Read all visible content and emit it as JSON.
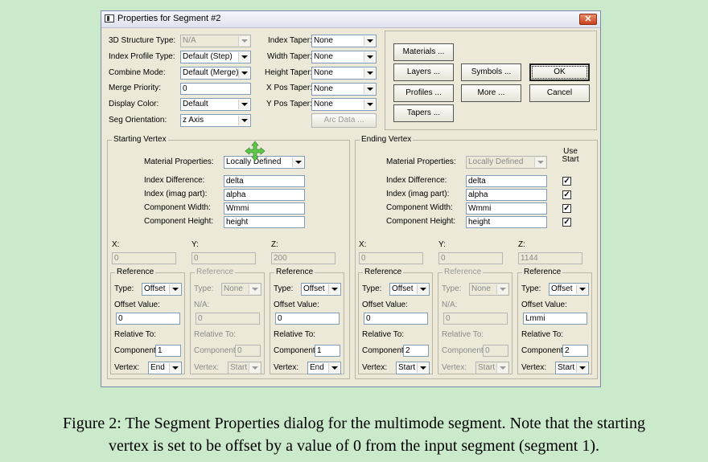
{
  "window": {
    "title": "Properties for Segment #2",
    "close": "✕"
  },
  "top_left": {
    "structure_type": {
      "label": "3D Structure Type:",
      "value": "N/A"
    },
    "index_profile": {
      "label": "Index Profile Type:",
      "value": "Default (Step)"
    },
    "combine_mode": {
      "label": "Combine Mode:",
      "value": "Default (Merge)"
    },
    "merge_priority": {
      "label": "Merge Priority:",
      "value": "0"
    },
    "display_color": {
      "label": "Display Color:",
      "value": "Default"
    },
    "seg_orientation": {
      "label": "Seg Orientation:",
      "value": "z Axis"
    }
  },
  "top_mid": {
    "index_taper": {
      "label": "Index Taper:",
      "value": "None"
    },
    "width_taper": {
      "label": "Width Taper:",
      "value": "None"
    },
    "height_taper": {
      "label": "Height Taper:",
      "value": "None"
    },
    "xpos_taper": {
      "label": "X Pos Taper:",
      "value": "None"
    },
    "ypos_taper": {
      "label": "Y Pos Taper:",
      "value": "None"
    },
    "arc_data": "Arc Data ..."
  },
  "buttons": {
    "materials": "Materials ...",
    "layers": "Layers ...",
    "profiles": "Profiles ...",
    "tapers": "Tapers ...",
    "symbols": "Symbols ...",
    "more": "More ...",
    "ok": "OK",
    "cancel": "Cancel"
  },
  "starting": {
    "title": "Starting Vertex",
    "mat_label": "Material Properties:",
    "mat_value": "Locally Defined",
    "idx_diff_label": "Index Difference:",
    "idx_diff": "delta",
    "idx_imag_label": "Index (imag part):",
    "idx_imag": "alpha",
    "width_label": "Component Width:",
    "width": "Wmmi",
    "height_label": "Component Height:",
    "height": "height",
    "x_label": "X:",
    "x": "0",
    "y_label": "Y:",
    "y": "0",
    "z_label": "Z:",
    "z": "200",
    "refs": [
      {
        "title": "Reference",
        "type_label": "Type:",
        "type": "Offset",
        "off_label": "Offset Value:",
        "off": "0",
        "rel_label": "Relative To:",
        "comp_label": "Component:",
        "comp": "1",
        "vert_label": "Vertex:",
        "vert": "End"
      },
      {
        "title": "Reference",
        "type_label": "Type:",
        "type": "None",
        "off_label": "N/A:",
        "off": "0",
        "rel_label": "Relative To:",
        "comp_label": "Component:",
        "comp": "0",
        "vert_label": "Vertex:",
        "vert": "Start"
      },
      {
        "title": "Reference",
        "type_label": "Type:",
        "type": "Offset",
        "off_label": "Offset Value:",
        "off": "0",
        "rel_label": "Relative To:",
        "comp_label": "Component:",
        "comp": "1",
        "vert_label": "Vertex:",
        "vert": "End"
      }
    ]
  },
  "ending": {
    "title": "Ending Vertex",
    "use_start": "Use Start",
    "mat_label": "Material Properties:",
    "mat_value": "Locally Defined",
    "idx_diff_label": "Index Difference:",
    "idx_diff": "delta",
    "idx_imag_label": "Index (imag part):",
    "idx_imag": "alpha",
    "width_label": "Component Width:",
    "width": "Wmmi",
    "height_label": "Component Height:",
    "height": "height",
    "check_mark": "✓",
    "x_label": "X:",
    "x": "0",
    "y_label": "Y:",
    "y": "0",
    "z_label": "Z:",
    "z": "1144",
    "refs": [
      {
        "title": "Reference",
        "type_label": "Type:",
        "type": "Offset",
        "off_label": "Offset Value:",
        "off": "0",
        "rel_label": "Relative To:",
        "comp_label": "Component:",
        "comp": "2",
        "vert_label": "Vertex:",
        "vert": "Start"
      },
      {
        "title": "Reference",
        "type_label": "Type:",
        "type": "None",
        "off_label": "N/A:",
        "off": "0",
        "rel_label": "Relative To:",
        "comp_label": "Component:",
        "comp": "0",
        "vert_label": "Vertex:",
        "vert": "Start"
      },
      {
        "title": "Reference",
        "type_label": "Type:",
        "type": "Offset",
        "off_label": "Offset Value:",
        "off": "Lmmi",
        "rel_label": "Relative To:",
        "comp_label": "Component:",
        "comp": "2",
        "vert_label": "Vertex:",
        "vert": "Start"
      }
    ]
  },
  "caption": {
    "line1": "Figure 2:  The Segment Properties dialog for the multimode segment. Note that the starting",
    "line2": "vertex is set to be offset by a value of 0 from the input segment (segment 1)."
  },
  "colors": {
    "page_bg": "#cbe9cb",
    "dialog_bg": "#ece9d8",
    "move_cursor": "#5fc84a"
  }
}
